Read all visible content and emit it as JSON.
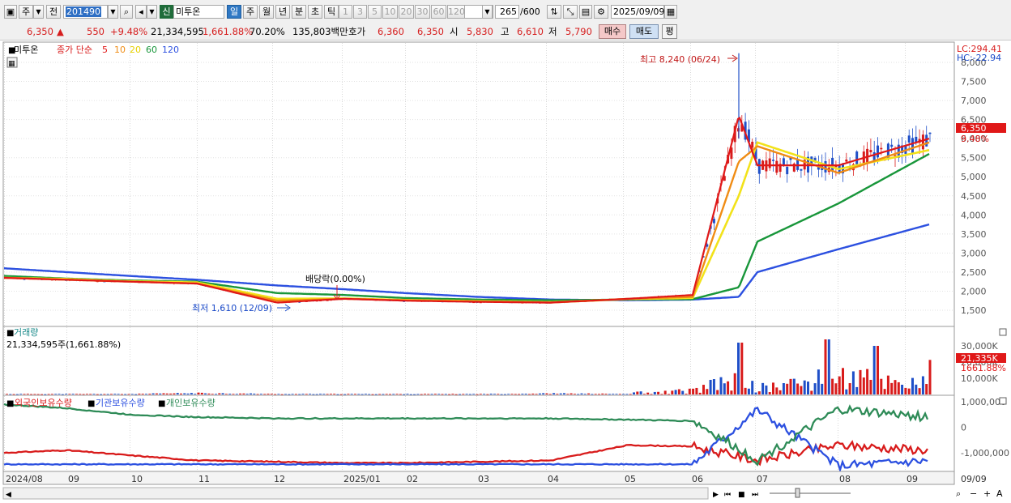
{
  "toolbar": {
    "market_btn": "주",
    "prev_btn": "전",
    "code_value": "201490",
    "badge": "신",
    "name_value": "미투온",
    "periods": [
      "일",
      "주",
      "월",
      "년",
      "분",
      "초",
      "틱"
    ],
    "active_period": "일",
    "intervals": [
      "1",
      "3",
      "5",
      "10",
      "20",
      "30",
      "60",
      "120"
    ],
    "count": "265",
    "count_total": "/600",
    "date": "2025/09/09"
  },
  "quote": {
    "price": "6,350",
    "arrow": "▲",
    "change": "550",
    "change_pct": "+9.48%",
    "volume": "21,334,595",
    "volume_pct": "1,661.88%",
    "turnover_pct": "70.20%",
    "amount": "135,803백만",
    "hoga_label": "호가",
    "ask": "6,360",
    "bid": "6,350",
    "open_label": "시",
    "open": "5,830",
    "high_label": "고",
    "high": "6,610",
    "low_label": "저",
    "low": "5,790",
    "buy_btn": "매수",
    "sell_btn": "매도",
    "eval_btn": "평"
  },
  "price_panel": {
    "stock_name": "미투온",
    "legend_prefix": "종가 단순",
    "ma_periods": [
      "5",
      "10",
      "20",
      "60",
      "120"
    ],
    "lc_label": "LC:294.41",
    "hc_label": "HC:-22.94",
    "price_badge": "6,350",
    "pct_badge": "9.48%",
    "high_note": "최고 8,240 (06/24)",
    "low_note": "최저 1,610 (12/09)",
    "dividend_note": "배당락(0.00%)",
    "y_ticks": [
      "8,000",
      "7,500",
      "7,000",
      "6,500",
      "6,000",
      "5,500",
      "5,000",
      "4,500",
      "4,000",
      "3,500",
      "3,000",
      "2,500",
      "2,000",
      "1,500"
    ]
  },
  "volume_panel": {
    "title": "거래량",
    "value_text": "21,334,595주(1,661.88%)",
    "y_ticks": [
      "30,000K",
      "20,000K",
      "10,000K"
    ],
    "badge": "21,335K",
    "pct": "1661.88%"
  },
  "holdings_panel": {
    "legend": [
      "외국인보유수량",
      "기관보유수량",
      "개인보유수량"
    ],
    "y_ticks": [
      "1,000,000",
      "0",
      "-1,000,000"
    ]
  },
  "x_axis": {
    "labels": [
      "2024/08",
      "09",
      "10",
      "11",
      "12",
      "2025/01",
      "02",
      "03",
      "04",
      "05",
      "06",
      "07",
      "08",
      "09"
    ],
    "current": "09/09"
  },
  "colors": {
    "ma5": "#e01818",
    "ma10": "#f08c14",
    "ma20": "#f2e21a",
    "ma60": "#18963a",
    "ma120": "#2c50e0",
    "up": "#d81b1b",
    "down": "#1f4fc8",
    "foreign": "#d81b1b",
    "inst": "#2c50e0",
    "indiv": "#2e8b57"
  },
  "chart_data": [
    {
      "type": "line",
      "title": "미투온",
      "x": [
        "2024/08",
        "09",
        "10",
        "11",
        "12",
        "2025/01",
        "02",
        "03",
        "04",
        "05",
        "06",
        "06/24",
        "07",
        "08",
        "09/09"
      ],
      "series": [
        {
          "name": "5",
          "values": [
            2350,
            2300,
            2250,
            2200,
            1700,
            1800,
            1750,
            1720,
            1700,
            1800,
            1900,
            6600,
            5300,
            5300,
            6000
          ]
        },
        {
          "name": "10",
          "values": [
            2350,
            2300,
            2250,
            2200,
            1750,
            1800,
            1760,
            1730,
            1700,
            1800,
            1850,
            5400,
            5800,
            5100,
            5900
          ]
        },
        {
          "name": "20",
          "values": [
            2350,
            2320,
            2260,
            2230,
            1800,
            1810,
            1770,
            1740,
            1710,
            1790,
            1820,
            4500,
            5900,
            5200,
            5700
          ]
        },
        {
          "name": "60",
          "values": [
            2400,
            2330,
            2280,
            2250,
            1950,
            1900,
            1820,
            1780,
            1760,
            1780,
            1790,
            2100,
            3300,
            4300,
            5600
          ]
        },
        {
          "name": "120",
          "values": [
            2600,
            2500,
            2400,
            2300,
            2150,
            2050,
            1950,
            1850,
            1780,
            1760,
            1780,
            1850,
            2500,
            3100,
            3750
          ]
        }
      ],
      "annotations": [
        "최고 8,240 (06/24)",
        "최저 1,610 (12/09)",
        "배당락(0.00%)"
      ],
      "ylim": [
        1500,
        8000
      ]
    },
    {
      "type": "bar",
      "title": "거래량",
      "x": [
        "2024/08",
        "09",
        "10",
        "11",
        "12",
        "2025/01",
        "02",
        "03",
        "04",
        "05",
        "06",
        "06/24",
        "07",
        "08",
        "09/09"
      ],
      "series": [
        {
          "name": "거래량",
          "values": [
            300,
            300,
            300,
            800,
            300,
            300,
            300,
            300,
            600,
            300,
            8000,
            32000,
            12000,
            34000,
            21335
          ]
        }
      ],
      "ylim": [
        0,
        35000
      ]
    },
    {
      "type": "line",
      "x": [
        "2024/08",
        "09",
        "10",
        "11",
        "12",
        "2025/01",
        "02",
        "03",
        "04",
        "05",
        "06",
        "07",
        "08",
        "09/09"
      ],
      "series": [
        {
          "name": "외국인보유수량",
          "values": [
            -1000000,
            -900000,
            -1100000,
            -1300000,
            -1350000,
            -1400000,
            -1400000,
            -1350000,
            -1300000,
            -700000,
            -750000,
            -1300000,
            -700000,
            -900000
          ]
        },
        {
          "name": "기관보유수량",
          "values": [
            -1450000,
            -1450000,
            -1450000,
            -1450000,
            -1450000,
            -1450000,
            -1450000,
            -1450000,
            -1450000,
            -1450000,
            -1450000,
            700000,
            -1500000,
            -1300000
          ]
        },
        {
          "name": "개인보유수량",
          "values": [
            900000,
            750000,
            500000,
            400000,
            350000,
            350000,
            350000,
            350000,
            350000,
            300000,
            250000,
            -1300000,
            700000,
            400000
          ]
        }
      ],
      "ylim": [
        -1700000,
        1100000
      ]
    }
  ]
}
